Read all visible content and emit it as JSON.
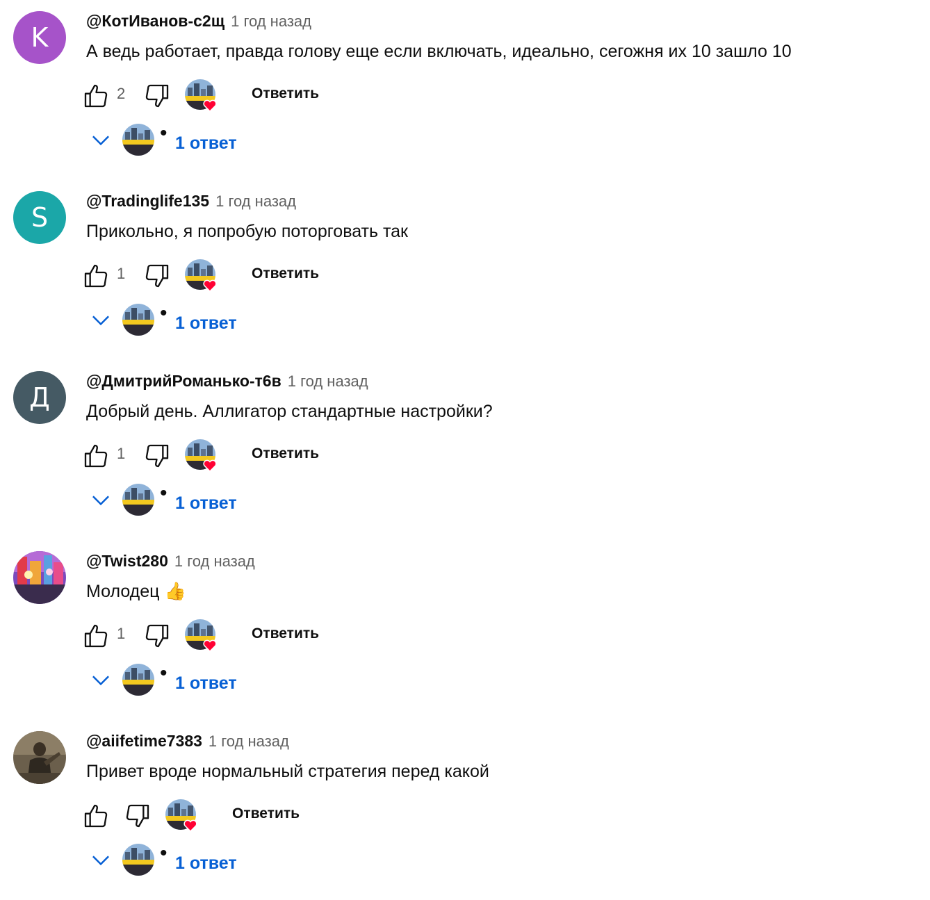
{
  "comments": [
    {
      "author": "@КотИванов-с2щ",
      "avatar_letter": "K",
      "avatar_color": "#a653c9",
      "time": "1 год назад",
      "text": "А ведь работает, правда голову еще если включать, идеально, сегожня их 10 зашло 10",
      "likes": "2",
      "reply_label": "Ответить",
      "replies_label": "1 ответ"
    },
    {
      "author": "@Tradinglife135",
      "avatar_letter": "S",
      "avatar_color": "#1ba7a8",
      "time": "1 год назад",
      "text": "Прикольно, я попробую поторговать так",
      "likes": "1",
      "reply_label": "Ответить",
      "replies_label": "1 ответ"
    },
    {
      "author": "@ДмитрийРоманько-т6в",
      "avatar_letter": "Д",
      "avatar_color": "#455a64",
      "time": "1 год назад",
      "text": "Добрый день. Аллигатор стандартные настройки?",
      "likes": "1",
      "reply_label": "Ответить",
      "replies_label": "1 ответ"
    },
    {
      "author": "@Twist280",
      "avatar_letter": "",
      "avatar_color": "#8a4fb3",
      "time": "1 год назад",
      "text": "Молодец 👍",
      "likes": "1",
      "reply_label": "Ответить",
      "replies_label": "1 ответ"
    },
    {
      "author": "@aiifetime7383",
      "avatar_letter": "",
      "avatar_color": "#5a4e3e",
      "time": "1 год назад",
      "text": "Привет вроде нормальный стратегия перед какой",
      "likes": "",
      "reply_label": "Ответить",
      "replies_label": "1 ответ"
    }
  ],
  "colors": {
    "link_blue": "#065fd4",
    "secondary_text": "#606060",
    "heart_red": "#ff0033"
  },
  "icons": {
    "like": "thumbs-up-icon",
    "dislike": "thumbs-down-icon",
    "creator_heart": "creator-heart-icon",
    "expand": "chevron-down-icon"
  }
}
